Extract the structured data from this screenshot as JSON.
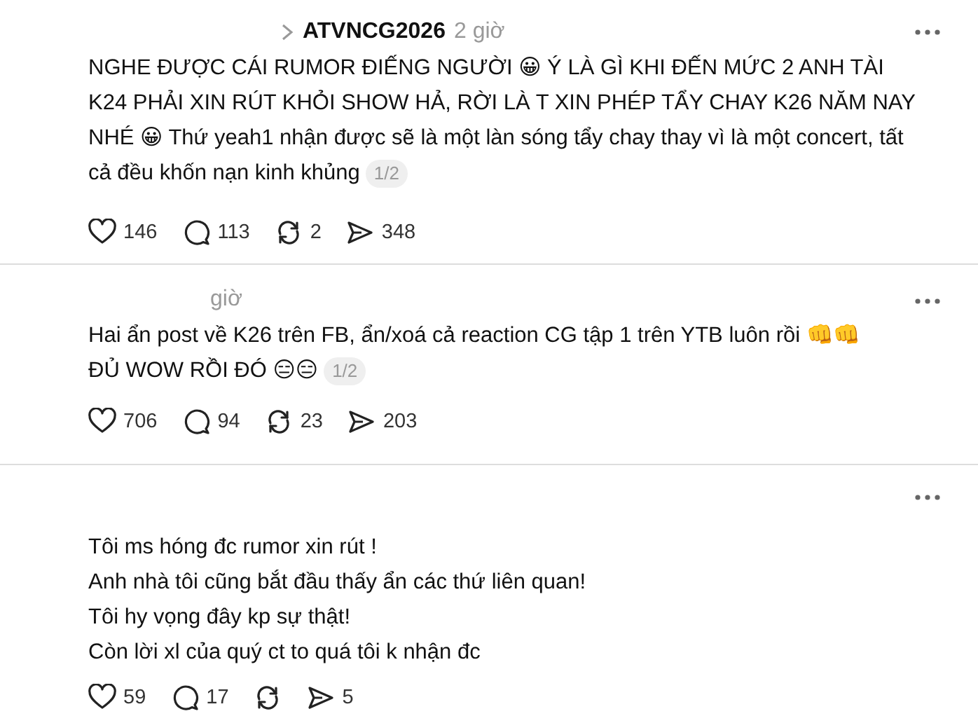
{
  "posts": [
    {
      "username": "ATVNCG2026",
      "time": "2 giờ",
      "text": "NGHE ĐƯỢC CÁI RUMOR ĐIẾNG NGƯỜI 😀 Ý LÀ GÌ KHI ĐẾN MỨC 2 ANH TÀI K24 PHẢI XIN RÚT KHỎI SHOW HẢ, RỜI LÀ T XIN PHÉP TẨY CHAY K26 NĂM NAY NHÉ 😀 Thứ yeah1 nhận được sẽ là một làn sóng tẩy chay thay vì là một concert, tất cả đều khốn nạn kinh khủng",
      "page": "1/2",
      "likes": "146",
      "comments": "113",
      "reposts": "2",
      "shares": "348"
    },
    {
      "time": "giờ",
      "text": "Hai ẩn post về K26 trên FB, ẩn/xoá cả reaction CG tập 1 trên YTB luôn rồi 👊👊\nĐỦ WOW RỒI ĐÓ 😑😑",
      "page": "1/2",
      "likes": "706",
      "comments": "94",
      "reposts": "23",
      "shares": "203"
    },
    {
      "text": "Tôi ms hóng đc rumor xin rút !\nAnh nhà tôi cũng bắt đầu thấy ẩn các thứ liên quan!\nTôi hy vọng đây kp sự thật!\nCòn lời xl của quý ct to quá tôi k nhận đc",
      "likes": "59",
      "comments": "17",
      "shares": "5"
    }
  ]
}
